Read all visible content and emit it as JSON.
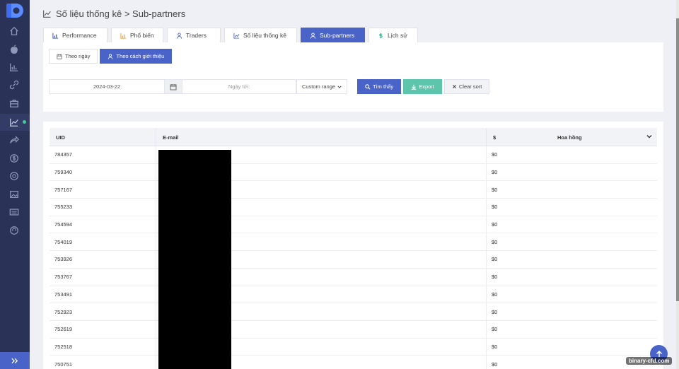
{
  "header": {
    "title": "Số liệu thống kê > Sub-partners"
  },
  "tabs": [
    {
      "label": "Performance",
      "icon": "bar-chart-icon",
      "active": false
    },
    {
      "label": "Phổ biến",
      "icon": "bar-chart-icon",
      "active": false
    },
    {
      "label": "Traders",
      "icon": "user-icon",
      "active": false
    },
    {
      "label": "Số liệu thống kê",
      "icon": "line-chart-icon",
      "active": false
    },
    {
      "label": "Sub-partners",
      "icon": "user-icon",
      "active": true
    },
    {
      "label": "Lịch sử",
      "icon": "dollar-icon",
      "active": false
    }
  ],
  "subtabs": [
    {
      "label": "Theo ngày",
      "icon": "calendar-icon",
      "active": false
    },
    {
      "label": "Theo cách giới thiệu",
      "icon": "user-icon",
      "active": true
    }
  ],
  "filters": {
    "date_from": "2024-03-22",
    "date_to_placeholder": "Ngày tới:",
    "range": "Custom range",
    "search_label": "Tìm thấy",
    "export_label": "Export",
    "clear_label": "Clear sort"
  },
  "table": {
    "headers": {
      "uid": "UID",
      "email": "E-mail",
      "currency": "$",
      "commission": "Hoa hồng"
    },
    "rows": [
      {
        "uid": "784357",
        "commission": "$0"
      },
      {
        "uid": "759340",
        "commission": "$0"
      },
      {
        "uid": "757167",
        "commission": "$0"
      },
      {
        "uid": "755233",
        "commission": "$0"
      },
      {
        "uid": "754594",
        "commission": "$0"
      },
      {
        "uid": "754019",
        "commission": "$0"
      },
      {
        "uid": "753926",
        "commission": "$0"
      },
      {
        "uid": "753767",
        "commission": "$0"
      },
      {
        "uid": "753491",
        "commission": "$0"
      },
      {
        "uid": "752923",
        "commission": "$0"
      },
      {
        "uid": "752619",
        "commission": "$0"
      },
      {
        "uid": "752518",
        "commission": "$0"
      },
      {
        "uid": "750751",
        "commission": "$0"
      }
    ]
  },
  "watermark": "binary-cfd.com",
  "colors": {
    "sidebar": "#2a3357",
    "accent": "#4a63c9",
    "export": "#5cc5ab",
    "status_dot": "#4cc79a"
  }
}
